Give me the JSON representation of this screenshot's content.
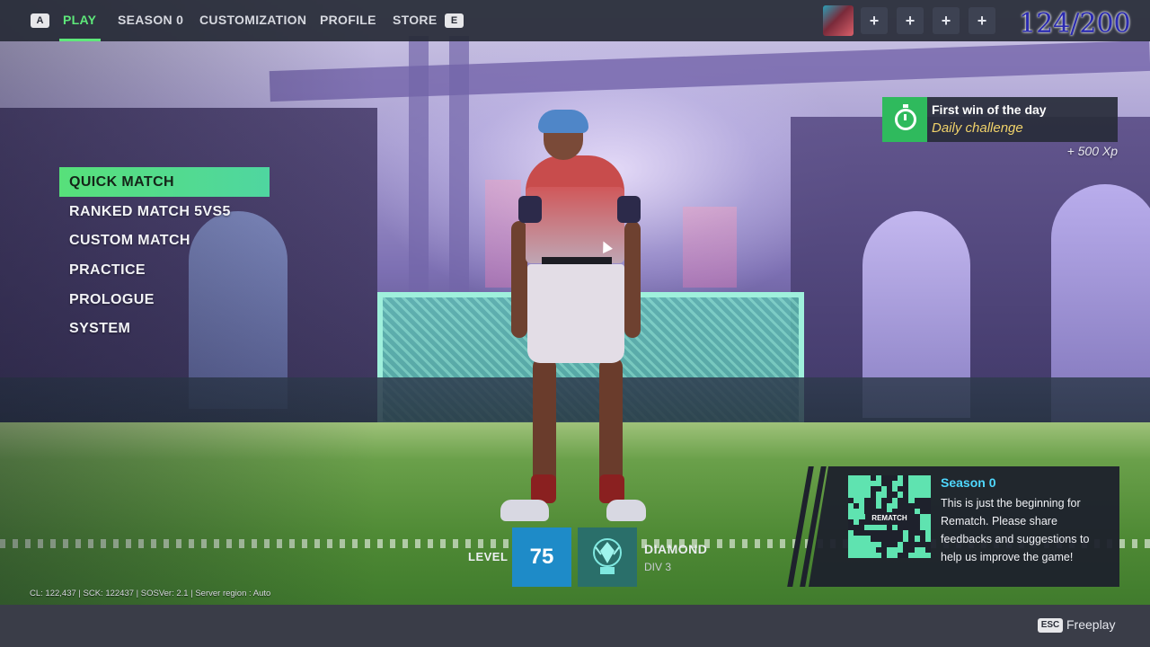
{
  "nav": {
    "prev_key": "A",
    "next_key": "E",
    "tabs": [
      {
        "label": "PLAY",
        "active": true
      },
      {
        "label": "SEASON 0",
        "active": false
      },
      {
        "label": "CUSTOMIZATION",
        "active": false
      },
      {
        "label": "PROFILE",
        "active": false
      },
      {
        "label": "STORE",
        "active": false
      }
    ],
    "party_slots": [
      "+",
      "+",
      "+",
      "+"
    ],
    "overlay_counter": "124/200"
  },
  "menu": {
    "items": [
      {
        "label": "QUICK MATCH",
        "selected": true
      },
      {
        "label": "RANKED MATCH 5VS5",
        "selected": false
      },
      {
        "label": "CUSTOM MATCH",
        "selected": false
      },
      {
        "label": "PRACTICE",
        "selected": false
      },
      {
        "label": "PROLOGUE",
        "selected": false
      },
      {
        "label": "SYSTEM",
        "selected": false
      }
    ]
  },
  "challenge": {
    "icon": "stopwatch-icon",
    "title": "First win of the day",
    "subtitle": "Daily challenge",
    "reward": "+ 500 Xp"
  },
  "season": {
    "qr_label": "REMATCH",
    "title": "Season 0",
    "body": "This is just the beginning for Rematch. Please share feedbacks and suggestions to help us improve the game!"
  },
  "player_stats": {
    "level_label": "LEVEL",
    "level": "75",
    "rank": "DIAMOND",
    "division": "DIV 3"
  },
  "footer": {
    "debug_info": "CL: 122,437 | SCK: 122437 | SOSVer: 2.1 | Server region : Auto",
    "esc_key": "ESC",
    "esc_label": "Freeplay"
  },
  "colors": {
    "accent_green": "#5ee87a",
    "level_blue": "#1e8bc8",
    "season_title": "#4fd8ff",
    "challenge_sub": "#f0d26a"
  }
}
